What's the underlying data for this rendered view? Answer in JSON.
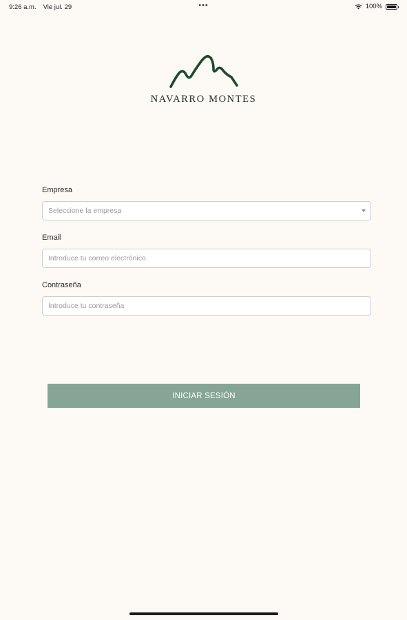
{
  "status_bar": {
    "time": "9:26 a.m.",
    "date": "Vie jul. 29",
    "dots": "•••",
    "battery_percent": "100%"
  },
  "brand": {
    "name": "NAVARRO MONTES",
    "logo_icon": "mountain-logo-icon",
    "color": "#1f4a2d"
  },
  "form": {
    "company": {
      "label": "Empresa",
      "placeholder": "Seleccione la empresa",
      "value": ""
    },
    "email": {
      "label": "Email",
      "placeholder": "Introduce tu correo electrónico",
      "value": ""
    },
    "password": {
      "label": "Contraseña",
      "placeholder": "Introduce tu contraseña",
      "value": ""
    },
    "submit_label": "INICIAR SESIÓN"
  },
  "colors": {
    "background": "#fdf9f5",
    "button": "#86a596",
    "logo": "#1f4a2d"
  }
}
